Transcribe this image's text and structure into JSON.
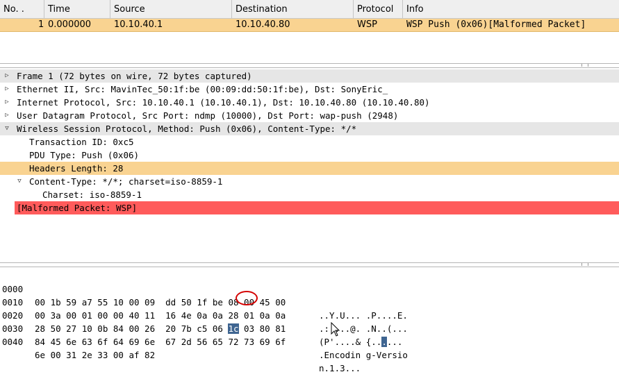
{
  "packet_list": {
    "columns": [
      "No. .",
      "Time",
      "Source",
      "Destination",
      "Protocol",
      "Info"
    ],
    "rows": [
      {
        "no": "1",
        "time": "0.000000",
        "source": "10.10.40.1",
        "destination": "10.10.40.80",
        "protocol": "WSP",
        "info": "WSP Push (0x06)[Malformed Packet]"
      }
    ]
  },
  "detail_tree": {
    "items": [
      {
        "text": "Frame 1 (72 bytes on wire, 72 bytes captured)",
        "expanded": false
      },
      {
        "text": "Ethernet II, Src: MavinTec_50:1f:be (00:09:dd:50:1f:be), Dst: SonyEric_",
        "expanded": false
      },
      {
        "text": "Internet Protocol, Src: 10.10.40.1 (10.10.40.1), Dst: 10.10.40.80 (10.10.40.80)",
        "expanded": false
      },
      {
        "text": "User Datagram Protocol, Src Port: ndmp (10000), Dst Port: wap-push (2948)",
        "expanded": false
      },
      {
        "text": "Wireless Session Protocol, Method: Push (0x06), Content-Type: */*",
        "expanded": true
      },
      {
        "text": "Transaction ID: 0xc5"
      },
      {
        "text": "PDU Type: Push (0x06)"
      },
      {
        "text": "Headers Length: 28",
        "selected": true
      },
      {
        "text": "Content-Type: */*; charset=iso-8859-1",
        "expanded": true
      },
      {
        "text": "Charset: iso-8859-1"
      },
      {
        "text": "[Malformed Packet: WSP]",
        "malformed": true
      }
    ]
  },
  "hex_dump": {
    "rows": [
      {
        "offset": "0000",
        "bytes_a": "00 1b 59 a7 55 10 00 09",
        "bytes_b": "dd 50 1f be 08 00 45 00",
        "ascii_a": "..Y.U...",
        "ascii_b": ".P....E."
      },
      {
        "offset": "0010",
        "bytes_a": "00 3a 00 01 00 00 40 11",
        "bytes_b": "16 4e 0a 0a 28 01 0a 0a",
        "ascii_a": ".:....@.",
        "ascii_b": ".N..(..."
      },
      {
        "offset": "0020",
        "bytes_a": "28 50 27 10 0b 84 00 26",
        "bytes_b_pre": "20 7b c5 06 ",
        "bytes_b_hl": "1c",
        "bytes_b_post": " 03 80 81",
        "ascii_a": "(P'....&",
        "ascii_b_pre": " {..",
        "ascii_b_hl": ".",
        "ascii_b_post": "..."
      },
      {
        "offset": "0030",
        "bytes_a": "84 45 6e 63 6f 64 69 6e",
        "bytes_b": "67 2d 56 65 72 73 69 6f",
        "ascii_a": ".Encodin",
        "ascii_b": "g-Versio"
      },
      {
        "offset": "0040",
        "bytes_a": "6e 00 31 2e 33 00 af 82",
        "bytes_b": "",
        "ascii_a": "n.1.3...",
        "ascii_b": ""
      }
    ]
  }
}
